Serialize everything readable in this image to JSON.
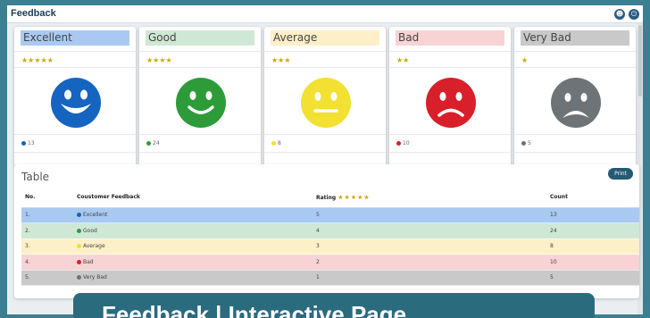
{
  "app": {
    "title": "Feedback",
    "icons": [
      "user-icon",
      "power-icon"
    ]
  },
  "cards": [
    {
      "label": "Excellent",
      "stars": "★★★★★",
      "count": "13",
      "color": "#1565c0",
      "header_bg": "#a9c9f2",
      "mood": "excellent"
    },
    {
      "label": "Good",
      "stars": "★★★★",
      "count": "24",
      "color": "#2e9b3a",
      "header_bg": "#cfe8d5",
      "mood": "good"
    },
    {
      "label": "Average",
      "stars": "★★★",
      "count": "8",
      "color": "#f2e033",
      "header_bg": "#fdf0c8",
      "mood": "average"
    },
    {
      "label": "Bad",
      "stars": "★★",
      "count": "10",
      "color": "#d81f2a",
      "header_bg": "#f7d3d6",
      "mood": "bad"
    },
    {
      "label": "Very Bad",
      "stars": "★",
      "count": "5",
      "color": "#6e7378",
      "header_bg": "#c9c9c9",
      "mood": "very-bad"
    }
  ],
  "table": {
    "title": "Table",
    "print_label": "Print",
    "headers": {
      "no": "No.",
      "feedback": "Coustomer Feedback",
      "rating": "Rating",
      "rating_stars": "★★★★★",
      "count": "Count"
    },
    "rows": [
      {
        "no": "1.",
        "feedback": "Excellent",
        "rating": "5",
        "count": "13",
        "color": "#1565c0",
        "bg": "#a9c9f2"
      },
      {
        "no": "2.",
        "feedback": "Good",
        "rating": "4",
        "count": "24",
        "color": "#2e9b3a",
        "bg": "#cfe8d5"
      },
      {
        "no": "3.",
        "feedback": "Average",
        "rating": "3",
        "count": "8",
        "color": "#f2e033",
        "bg": "#fdf0c8"
      },
      {
        "no": "4.",
        "feedback": "Bad",
        "rating": "2",
        "count": "10",
        "color": "#d81f2a",
        "bg": "#f7d3d6"
      },
      {
        "no": "5.",
        "feedback": "Very Bad",
        "rating": "1",
        "count": "5",
        "color": "#6e7378",
        "bg": "#c9c9c9"
      }
    ]
  },
  "banner": {
    "text": "Feedback | Interactive Page"
  }
}
